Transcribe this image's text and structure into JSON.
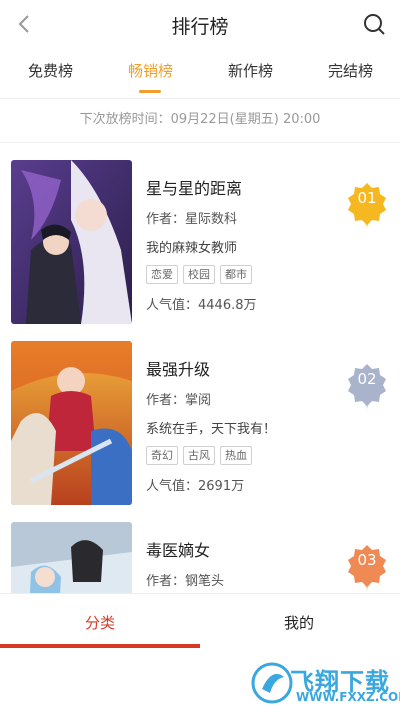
{
  "header": {
    "title": "排行榜",
    "back_icon": "chevron-left-icon",
    "search_icon": "search-icon"
  },
  "tabs": [
    {
      "label": "免费榜",
      "active": false
    },
    {
      "label": "畅销榜",
      "active": true
    },
    {
      "label": "新作榜",
      "active": false
    },
    {
      "label": "完结榜",
      "active": false
    }
  ],
  "schedule_text": "下次放榜时间：09月22日(星期五) 20:00",
  "books": [
    {
      "rank": "01",
      "rank_color": "#f5b820",
      "title": "星与星的距离",
      "author": "作者：星际数科",
      "desc": "我的麻辣女教师",
      "tags": [
        "恋爱",
        "校园",
        "都市"
      ],
      "popularity": "人气值：4446.8万"
    },
    {
      "rank": "02",
      "rank_color": "#a9b3cc",
      "title": "最强升级",
      "author": "作者：掌阅",
      "desc": "系统在手，天下我有！",
      "tags": [
        "奇幻",
        "古风",
        "热血"
      ],
      "popularity": "人气值：2691万"
    },
    {
      "rank": "03",
      "rank_color": "#f08a55",
      "title": "毒医嫡女",
      "author": "作者：钢笔头",
      "desc": "",
      "tags": [],
      "popularity": ""
    }
  ],
  "bottom_nav": [
    {
      "label": "分类",
      "active": true
    },
    {
      "label": "我的",
      "active": false
    }
  ],
  "watermark": {
    "text": "飞翔下载",
    "url": "WWW.FXXZ.COM"
  },
  "colors": {
    "accent": "#f0a02a",
    "nav_active": "#d63a25"
  }
}
